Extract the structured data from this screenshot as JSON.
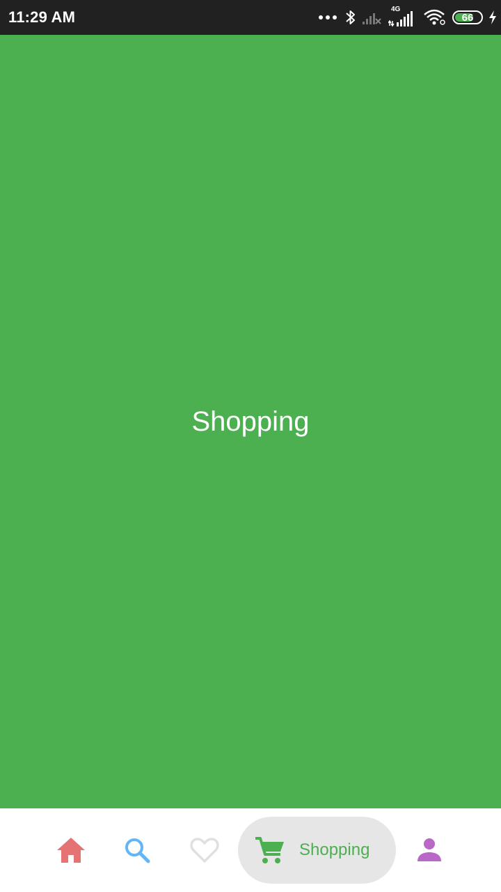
{
  "status_bar": {
    "time": "11:29 AM",
    "battery": "66",
    "network_label": "4G"
  },
  "main": {
    "title": "Shopping",
    "background_color": "#4CAF50"
  },
  "bottom_nav": {
    "items": [
      {
        "id": "home",
        "icon": "home-icon",
        "color": "#E57373",
        "selected": false
      },
      {
        "id": "search",
        "icon": "search-icon",
        "color": "#64B5F6",
        "selected": false
      },
      {
        "id": "likes",
        "icon": "heart-outline-icon",
        "color": "#E0E0E0",
        "selected": false
      },
      {
        "id": "shopping",
        "icon": "cart-icon",
        "label": "Shopping",
        "color": "#4CAF50",
        "selected": true
      },
      {
        "id": "profile",
        "icon": "person-icon",
        "color": "#BA68C8",
        "selected": false
      }
    ]
  }
}
